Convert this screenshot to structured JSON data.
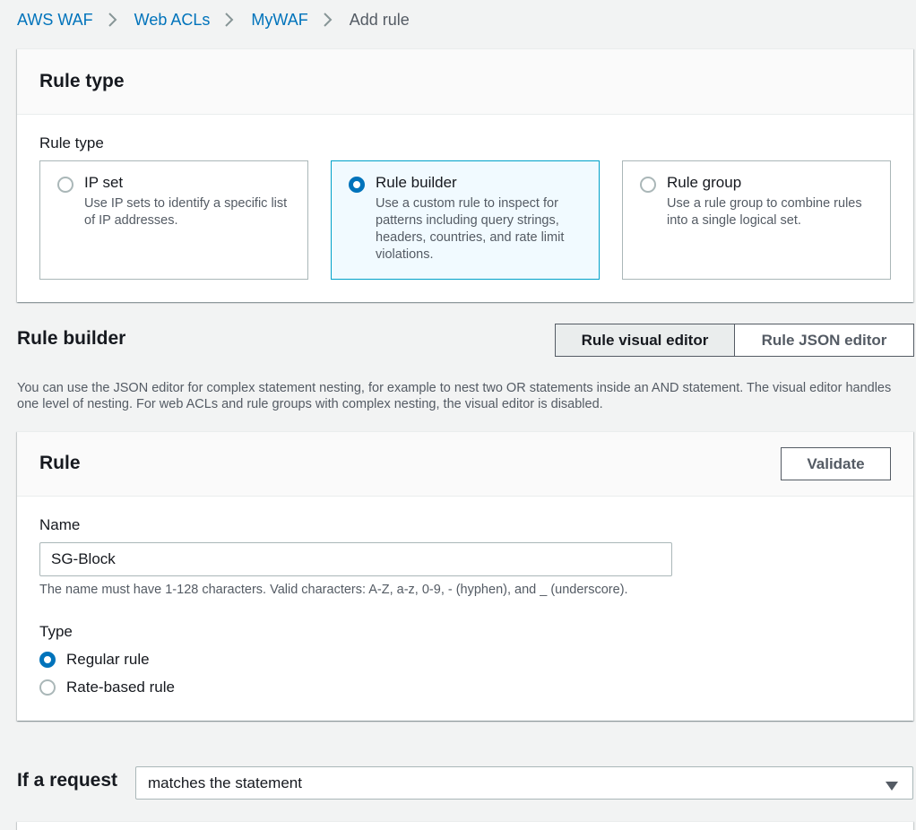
{
  "breadcrumb": {
    "items": [
      "AWS WAF",
      "Web ACLs",
      "MyWAF"
    ],
    "current": "Add rule"
  },
  "rule_type_panel": {
    "title": "Rule type",
    "field_label": "Rule type",
    "options": [
      {
        "title": "IP set",
        "description": "Use IP sets to identify a specific list of IP addresses.",
        "selected": false
      },
      {
        "title": "Rule builder",
        "description": "Use a custom rule to inspect for patterns including query strings, headers, countries, and rate limit violations.",
        "selected": true
      },
      {
        "title": "Rule group",
        "description": "Use a rule group to combine rules into a single logical set.",
        "selected": false
      }
    ]
  },
  "rule_builder": {
    "title": "Rule builder",
    "visual_editor_label": "Rule visual editor",
    "json_editor_label": "Rule JSON editor",
    "active_editor": "visual",
    "description": "You can use the JSON editor for complex statement nesting, for example to nest two OR statements inside an AND statement. The visual editor handles one level of nesting. For web ACLs and rule groups with complex nesting, the visual editor is disabled."
  },
  "rule_panel": {
    "title": "Rule",
    "validate_label": "Validate",
    "name_label": "Name",
    "name_value": "SG-Block",
    "name_hint": "The name must have 1-128 characters. Valid characters: A-Z, a-z, 0-9, - (hyphen), and _ (underscore).",
    "type_label": "Type",
    "type_options": [
      {
        "label": "Regular rule",
        "checked": true
      },
      {
        "label": "Rate-based rule",
        "checked": false
      }
    ]
  },
  "if_request": {
    "label": "If a request",
    "selected": "matches the statement"
  },
  "colors": {
    "link": "#0073bb",
    "selected_border": "#00a1c9",
    "selected_bg": "#f1faff",
    "page_bg": "#f2f3f3"
  }
}
